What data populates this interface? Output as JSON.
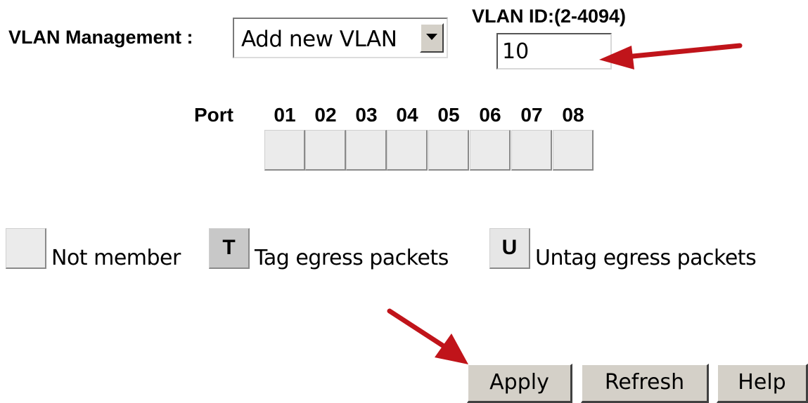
{
  "vlan_management": {
    "label": "VLAN Management :",
    "selected": "Add new VLAN"
  },
  "vlan_id": {
    "label": "VLAN ID:(2-4094)",
    "value": "10"
  },
  "ports": {
    "label": "Port",
    "numbers": [
      "01",
      "02",
      "03",
      "04",
      "05",
      "06",
      "07",
      "08"
    ]
  },
  "legend": {
    "not_member": "Not member",
    "tag_letter": "T",
    "tag": "Tag egress packets",
    "untag_letter": "U",
    "untag": "Untag egress packets"
  },
  "buttons": {
    "apply": "Apply",
    "refresh": "Refresh",
    "help": "Help"
  },
  "colors": {
    "annotation_arrow": "#c0141a",
    "button_face": "#d4d0c8"
  }
}
